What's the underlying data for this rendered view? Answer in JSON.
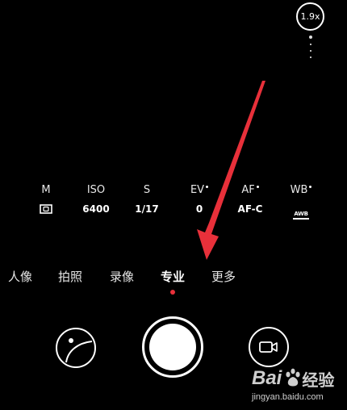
{
  "zoom": {
    "label": "1.9x"
  },
  "pro_params": [
    {
      "label": "M",
      "value": "",
      "icon": "metering-icon"
    },
    {
      "label": "ISO",
      "value": "6400"
    },
    {
      "label": "S",
      "value": "1/17"
    },
    {
      "label": "EV",
      "value": "0",
      "indicator": true
    },
    {
      "label": "AF",
      "value": "AF-C",
      "indicator": true
    },
    {
      "label": "WB",
      "value": "",
      "icon": "awb-icon",
      "icon_text": "AWB",
      "indicator": true
    }
  ],
  "modes": [
    {
      "label": "人像"
    },
    {
      "label": "拍照"
    },
    {
      "label": "录像"
    },
    {
      "label": "专业",
      "active": true
    },
    {
      "label": "更多"
    }
  ],
  "colors": {
    "background": "#000000",
    "arrow": "#e8303a",
    "indicator": "#e8303a"
  },
  "watermark": {
    "logo_part1": "Bai",
    "logo_part2": "经验",
    "url": "jingyan.baidu.com"
  }
}
